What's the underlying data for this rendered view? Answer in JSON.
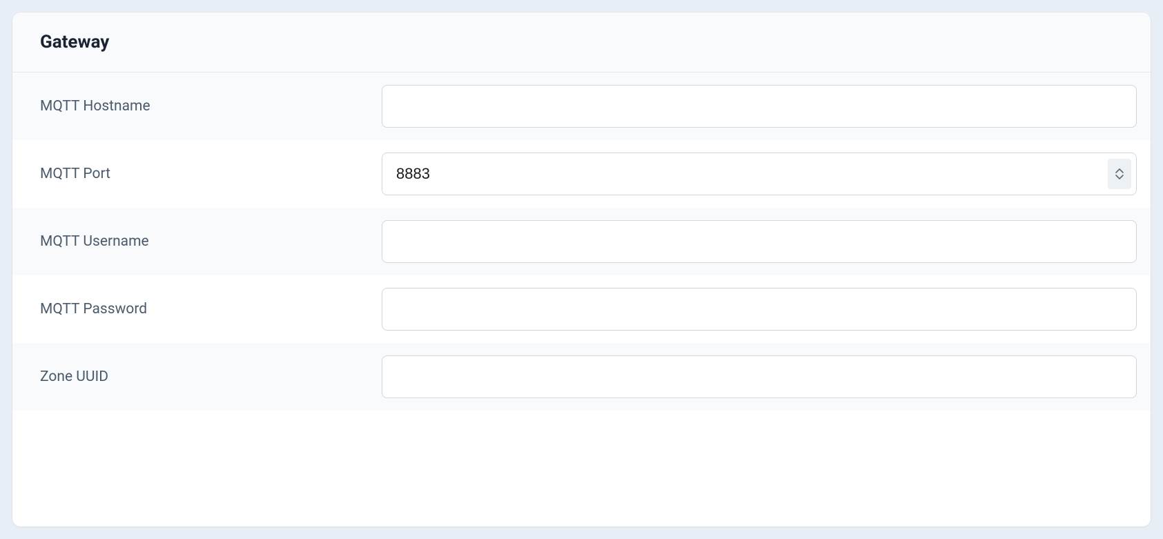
{
  "card": {
    "title": "Gateway"
  },
  "fields": {
    "hostname": {
      "label": "MQTT Hostname",
      "value": ""
    },
    "port": {
      "label": "MQTT Port",
      "value": "8883"
    },
    "username": {
      "label": "MQTT Username",
      "value": ""
    },
    "password": {
      "label": "MQTT Password",
      "value": ""
    },
    "zone_uuid": {
      "label": "Zone UUID",
      "value": ""
    }
  }
}
